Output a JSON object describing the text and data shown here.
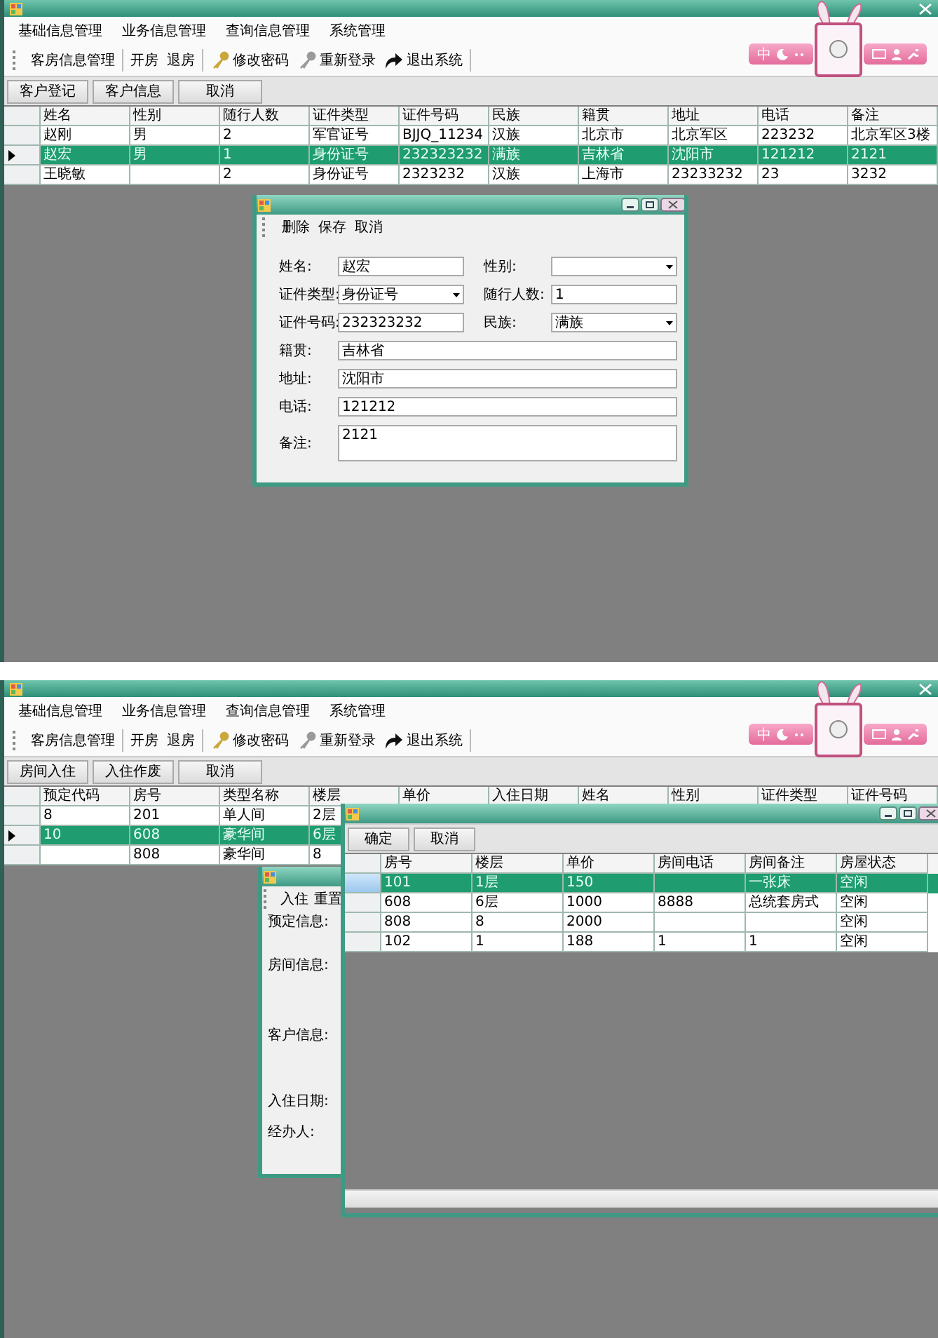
{
  "screens": [
    {
      "menu": [
        "基础信息管理",
        "业务信息管理",
        "查询信息管理",
        "系统管理"
      ],
      "toolbar_groups": [
        {
          "items": [
            {
              "label": "客房信息管理"
            }
          ]
        },
        {
          "items": [
            {
              "label": "开房"
            },
            {
              "label": "退房"
            }
          ]
        },
        {
          "items": [
            {
              "label": "修改密码"
            },
            {
              "label": "重新登录"
            },
            {
              "label": "退出系统"
            }
          ]
        }
      ],
      "ime_bar": {
        "label": "中"
      },
      "actions": [
        "客户登记",
        "客户信息",
        "取消"
      ],
      "grid": {
        "columns": [
          "姓名",
          "性别",
          "随行人数",
          "证件类型",
          "证件号码",
          "民族",
          "籍贯",
          "地址",
          "电话",
          "备注"
        ],
        "rows": [
          {
            "selected": false,
            "cells": [
              "赵刚",
              "男",
              "2",
              "军官证号",
              "BJJQ_11234",
              "汉族",
              "北京市",
              "北京军区",
              "223232",
              "北京军区3楼"
            ]
          },
          {
            "selected": true,
            "cells": [
              "赵宏",
              "男",
              "1",
              "身份证号",
              "232323232",
              "满族",
              "吉林省",
              "沈阳市",
              "121212",
              "2121"
            ]
          },
          {
            "selected": false,
            "cells": [
              "王晓敏",
              "",
              "2",
              "身份证号",
              "2323232",
              "汉族",
              "上海市",
              "23233232",
              "23",
              "3232"
            ]
          }
        ]
      },
      "dialogs": [
        {
          "kind": "customer_form",
          "toolbar": [
            "删除",
            "保存",
            "取消"
          ],
          "fields": [
            {
              "kind": "text",
              "label": "姓名:",
              "value": "赵宏"
            },
            {
              "kind": "select",
              "label": "性别:"
            },
            {
              "kind": "select",
              "label": "证件类型:",
              "value": "身份证号"
            },
            {
              "kind": "text",
              "label": "随行人数:",
              "value": "1"
            },
            {
              "kind": "text",
              "label": "证件号码:",
              "value": "232323232"
            },
            {
              "kind": "select",
              "label": "民族:",
              "value": "满族"
            },
            {
              "kind": "wide",
              "label": "籍贯:",
              "value": "吉林省"
            },
            {
              "kind": "wide",
              "label": "地址:",
              "value": "沈阳市"
            },
            {
              "kind": "wide",
              "label": "电话:",
              "value": "121212"
            },
            {
              "kind": "memo",
              "label": "备注:",
              "value": "2121"
            }
          ]
        }
      ]
    },
    {
      "menu": [
        "基础信息管理",
        "业务信息管理",
        "查询信息管理",
        "系统管理"
      ],
      "toolbar_groups": [
        {
          "items": [
            {
              "label": "客房信息管理"
            }
          ]
        },
        {
          "items": [
            {
              "label": "开房"
            },
            {
              "label": "退房"
            }
          ]
        },
        {
          "items": [
            {
              "label": "修改密码"
            },
            {
              "label": "重新登录"
            },
            {
              "label": "退出系统"
            }
          ]
        }
      ],
      "ime_bar": {
        "label": "中"
      },
      "actions": [
        "房间入住",
        "入住作废",
        "取消"
      ],
      "grid": {
        "columns": [
          "预定代码",
          "房号",
          "类型名称",
          "楼层",
          "单价",
          "入住日期",
          "姓名",
          "性别",
          "证件类型",
          "证件号码"
        ],
        "rows": [
          {
            "selected": false,
            "cells": [
              "8",
              "201",
              "单人间",
              "2层"
            ]
          },
          {
            "selected": true,
            "cells": [
              "10",
              "608",
              "豪华间",
              "6层"
            ]
          },
          {
            "selected": false,
            "cells": [
              "",
              "808",
              "豪华间",
              "8"
            ]
          }
        ]
      },
      "dialogs": [
        {
          "kind": "checkin_form",
          "toolbar": [
            "入住",
            "重置"
          ],
          "labels": [
            "预定信息:",
            "房间信息:",
            "客户信息:",
            "入住日期:",
            "经办人:"
          ]
        },
        {
          "kind": "room_picker",
          "actions": [
            "确定",
            "取消"
          ],
          "grid": {
            "columns": [
              "房号",
              "楼层",
              "单价",
              "房间电话",
              "房间备注",
              "房屋状态"
            ],
            "rows": [
              {
                "selected": true,
                "cells": [
                  "101",
                  "1层",
                  "150",
                  "",
                  "一张床",
                  "空闲"
                ]
              },
              {
                "selected": false,
                "cells": [
                  "608",
                  "6层",
                  "1000",
                  "8888",
                  "总统套房式",
                  "空闲"
                ]
              },
              {
                "selected": false,
                "cells": [
                  "808",
                  "8",
                  "2000",
                  "",
                  "",
                  "空闲"
                ]
              },
              {
                "selected": false,
                "cells": [
                  "102",
                  "1",
                  "188",
                  "1",
                  "1",
                  "空闲"
                ]
              }
            ]
          }
        }
      ]
    }
  ]
}
